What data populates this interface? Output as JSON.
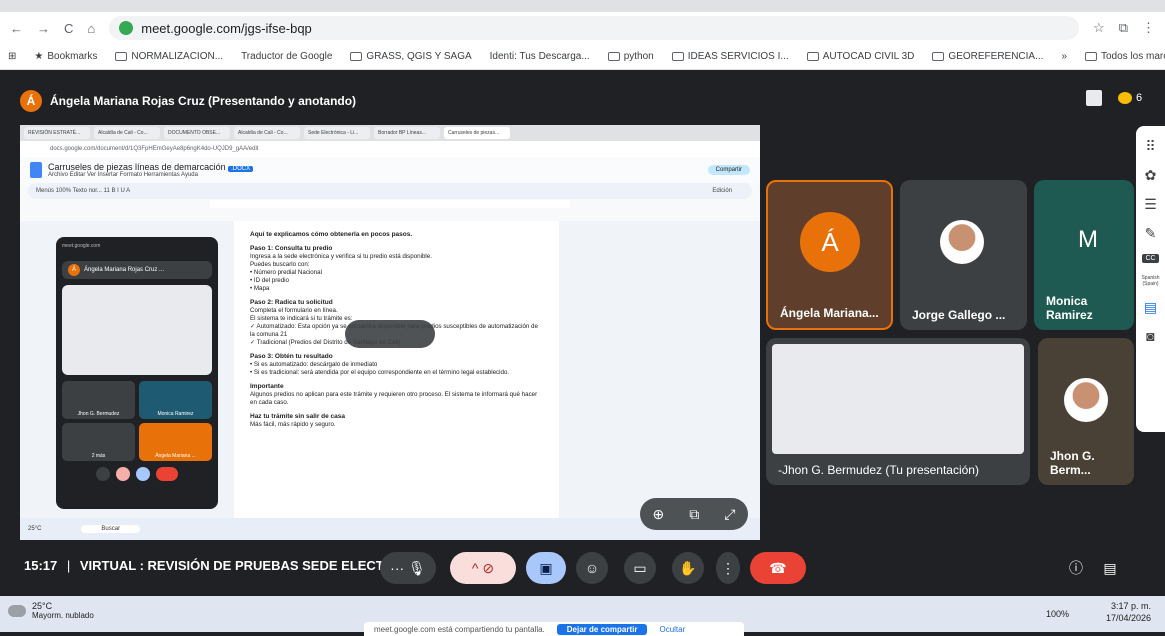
{
  "browser": {
    "url": "meet.google.com/jgs-ifse-bqp"
  },
  "bookmarks": [
    "Bookmarks",
    "NORMALIZACION...",
    "Traductor de Google",
    "GRASS, QGIS Y SAGA",
    "Identi: Tus Descarga...",
    "python",
    "IDEAS SERVICIOS I...",
    "AUTOCAD CIVIL 3D",
    "GEOREFERENCIA...",
    "»",
    "Todos los marcadores"
  ],
  "presenter": {
    "initial": "Á",
    "label": "Ángela Mariana Rojas Cruz (Presentando y anotando)",
    "people_count": "6"
  },
  "shared_screen": {
    "tabs": [
      "REVISIÓN ESTRATÉ...",
      "Alcaldía de Cali - Co...",
      "DOCUMENTO OBSE...",
      "Alcaldía de Cali - Co...",
      "Sede Electrónica - Li...",
      "Borrador BP Líneas...",
      "Carruseles de piezas..."
    ],
    "url": "docs.google.com/document/d/1Q3FpHEmGeyAe8p6ngK4do-UQJD9_gAA/edit",
    "doc_title": "Carruseles de piezas líneas de demarcación",
    "doc_badge": ".DOCX",
    "menu": "Archivo  Editar  Ver  Insertar  Formato  Herramientas  Ayuda",
    "share_label": "Compartir",
    "toolbar_text": "Menús   100%   Texto nor...   11   B  I  U  A",
    "edit_label": "Edición",
    "doc_lines": [
      {
        "t": "Aquí te explicamos cómo obtenerla en pocos pasos.",
        "b": true
      },
      {
        "t": "Paso 1: Consulta tu predio",
        "b": true
      },
      {
        "t": "Ingresa a la sede electrónica y verifica si tu predio está disponible.",
        "b": false
      },
      {
        "t": "Puedes buscarlo con:",
        "b": false
      },
      {
        "t": "• Número predial Nacional",
        "b": false
      },
      {
        "t": "• ID del predio",
        "b": false
      },
      {
        "t": "• Mapa",
        "b": false
      },
      {
        "t": "Paso 2: Radica tu solicitud",
        "b": true
      },
      {
        "t": "Completa el formulario en línea.",
        "b": false
      },
      {
        "t": "El sistema te indicará si tu trámite es:",
        "b": false
      },
      {
        "t": "✓ Automatizado: Esta opción ya se encuentra disponible para predios susceptibles de automatización de la comuna 21",
        "b": false
      },
      {
        "t": "✓ Tradicional (Predios del Distrito de Santiago de Cali)",
        "b": false
      },
      {
        "t": "Paso 3: Obtén tu resultado",
        "b": true
      },
      {
        "t": "• Si es automatizado: descárgalo de inmediato",
        "b": false
      },
      {
        "t": "• Si es tradicional: será atendida por el equipo correspondiente en el término legal establecido.",
        "b": false
      },
      {
        "t": "Importante",
        "b": true
      },
      {
        "t": "Algunos predios no aplican para este trámite y requieren otro proceso. El sistema te informará qué hacer en cada caso.",
        "b": false
      },
      {
        "t": "Haz tu trámite sin salir de casa",
        "b": true
      },
      {
        "t": "Más fácil, más rápido y seguro.",
        "b": false
      }
    ],
    "pip": {
      "site": "meet.google.com",
      "name": "Ángela Mariana Rojas Cruz ...",
      "tiles": [
        "Jhon G. Bermudez",
        "Monica Ramirez",
        "2 más",
        "Ángela Mariana ..."
      ]
    },
    "taskbar": {
      "temp": "25°C",
      "weather": "Mayorm. nublado",
      "search": "Buscar"
    }
  },
  "participants": [
    {
      "name": "Ángela Mariana...",
      "initial": "Á"
    },
    {
      "name": "Jorge Gallego ..."
    },
    {
      "name": "Monica Ramirez",
      "initial": "M"
    },
    {
      "name": "-Jhon G. Bermudez (Tu presentación)"
    },
    {
      "name": "Jhon G. Berm..."
    }
  ],
  "side_panel": {
    "cc": "CC",
    "lang": "Spanish (Spain)"
  },
  "meeting": {
    "time": "15:17",
    "separator": "|",
    "title": "VIRTUAL : REVISIÓN DE PRUEBAS SEDE ELECTR..."
  },
  "taskbar": {
    "temp": "25°C",
    "weather": "Mayorm. nublado",
    "share_msg": "meet.google.com está compartiendo tu pantalla.",
    "stop_share": "Dejar de compartir",
    "hide": "Ocultar",
    "battery": "100%",
    "time": "3:17 p. m.",
    "date": "17/04/2026"
  },
  "colors": {
    "accent": "#1a73e8",
    "end_call": "#ea4335",
    "presenter_avatar": "#e8710a",
    "meet_bg": "#202124"
  }
}
